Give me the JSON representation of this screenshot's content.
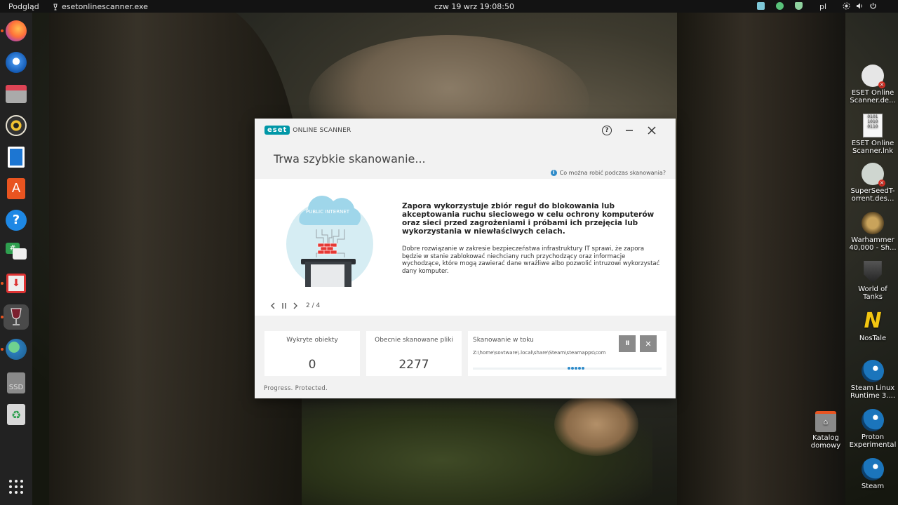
{
  "topbar": {
    "activities": "Podgląd",
    "app_name": "esetonlinescanner.exe",
    "clock": "czw 19 wrz  19:08:50",
    "language": "pl"
  },
  "dock": [
    {
      "name": "firefox",
      "color": "#e66000"
    },
    {
      "name": "thunderbird",
      "color": "#1a73e8"
    },
    {
      "name": "files",
      "color": "#c44"
    },
    {
      "name": "rhythmbox",
      "color": "#e0a800"
    },
    {
      "name": "writer",
      "color": "#1565c0"
    },
    {
      "name": "app-center",
      "color": "#e95420"
    },
    {
      "name": "help",
      "color": "#1e88e5"
    },
    {
      "name": "chat",
      "color": "#2e7d32"
    },
    {
      "name": "installer",
      "color": "#c62828"
    },
    {
      "name": "wine",
      "color": "#7b1f2e"
    },
    {
      "name": "globe",
      "color": "#2e7d5b"
    },
    {
      "name": "ssd",
      "label": "SSD",
      "color": "#777"
    },
    {
      "name": "trash",
      "color": "#888"
    }
  ],
  "desktop_icons": [
    {
      "label": "ESET Online Scanner.de...",
      "icon": "eset-shortcut-icon"
    },
    {
      "label": "ESET Online Scanner.lnk",
      "icon": "lnk-file-icon"
    },
    {
      "label": "SuperSeedT-orrent.des...",
      "icon": "torrent-shortcut-icon"
    },
    {
      "label": "Warhammer 40,000 - Sh...",
      "icon": "warhammer-icon"
    },
    {
      "label": "World of Tanks",
      "icon": "tanks-icon"
    },
    {
      "label": "NosTale",
      "icon": "nostale-icon"
    },
    {
      "label": "Steam Linux Runtime 3....",
      "icon": "steam-icon"
    },
    {
      "label": "Proton Experimental",
      "icon": "steam-icon"
    },
    {
      "label": "Steam",
      "icon": "steam-icon"
    }
  ],
  "home_folder": {
    "label": "Katalog domowy"
  },
  "eset": {
    "logo": "eset",
    "logo_sub": "ONLINE SCANNER",
    "help_glyph": "?",
    "title": "Trwa szybkie skanowanie...",
    "hint": "Co można robić podczas skanowania?",
    "illustration_label": "PUBLIC INTERNET",
    "heading": "Zapora wykorzystuje zbiór reguł do blokowania lub akceptowania ruchu sieciowego w celu ochrony komputerów oraz sieci przed zagrożeniami i próbami ich przejęcia lub wykorzystania w niewłaściwych celach.",
    "body": "Dobre rozwiązanie w zakresie bezpieczeństwa infrastruktury IT sprawi, że zapora będzie w stanie zablokować niechciany ruch przychodzący oraz informacje wychodzące, które mogą zawierać dane wrażliwe albo pozwolić intruzowi wykorzystać dany komputer.",
    "pager": "2 / 4",
    "stats": {
      "detected_label": "Wykryte obiekty",
      "detected_value": "0",
      "files_label": "Obecnie skanowane pliki",
      "files_value": "2277",
      "scan_label": "Skanowanie w toku",
      "scan_path": "Z:\\home\\sovtware\\.local\\share\\Steam\\steamapps\\common\\",
      "pause_glyph": "II",
      "stop_glyph": "✕"
    },
    "footer": "Progress. Protected."
  },
  "colors": {
    "accent": "#0097a7",
    "firewall": "#e53935",
    "cloud": "#9fd6ea"
  }
}
